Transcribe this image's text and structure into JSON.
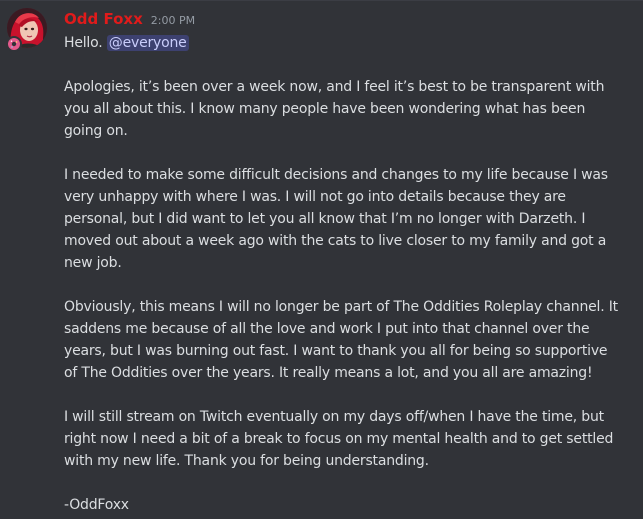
{
  "message": {
    "username": "Odd Foxx",
    "username_color": "#e01b1b",
    "timestamp": "2:00 PM",
    "avatar_icon": "fox-avatar",
    "badge_icon": "donut-badge-icon",
    "greeting": "Hello.",
    "mention": "@everyone",
    "paragraphs": [
      "Apologies, it’s been over a week now, and I feel it’s best to be transparent with you all about this. I know many people have been wondering what has been going on.",
      "I needed to make some difficult decisions and changes to my life because I was very unhappy with where I was. I will not go into details because they are personal, but I did want to let you all know that I’m no longer with Darzeth. I moved out about a week ago with the cats to live closer to my family and got a new job.",
      "Obviously, this means I will no longer be part of The Oddities Roleplay channel. It saddens me because of all the love and work I put into that channel over the years, but I was burning out fast. I want to thank you all for being so supportive of The Oddities over the years. It really means a lot, and you all are amazing!",
      "I will still stream on Twitch eventually on my days off/when I have the time, but right now I need a bit of a break to focus on my mental health and to get settled with my new life. Thank you for being understanding.",
      "-OddFoxx"
    ]
  }
}
